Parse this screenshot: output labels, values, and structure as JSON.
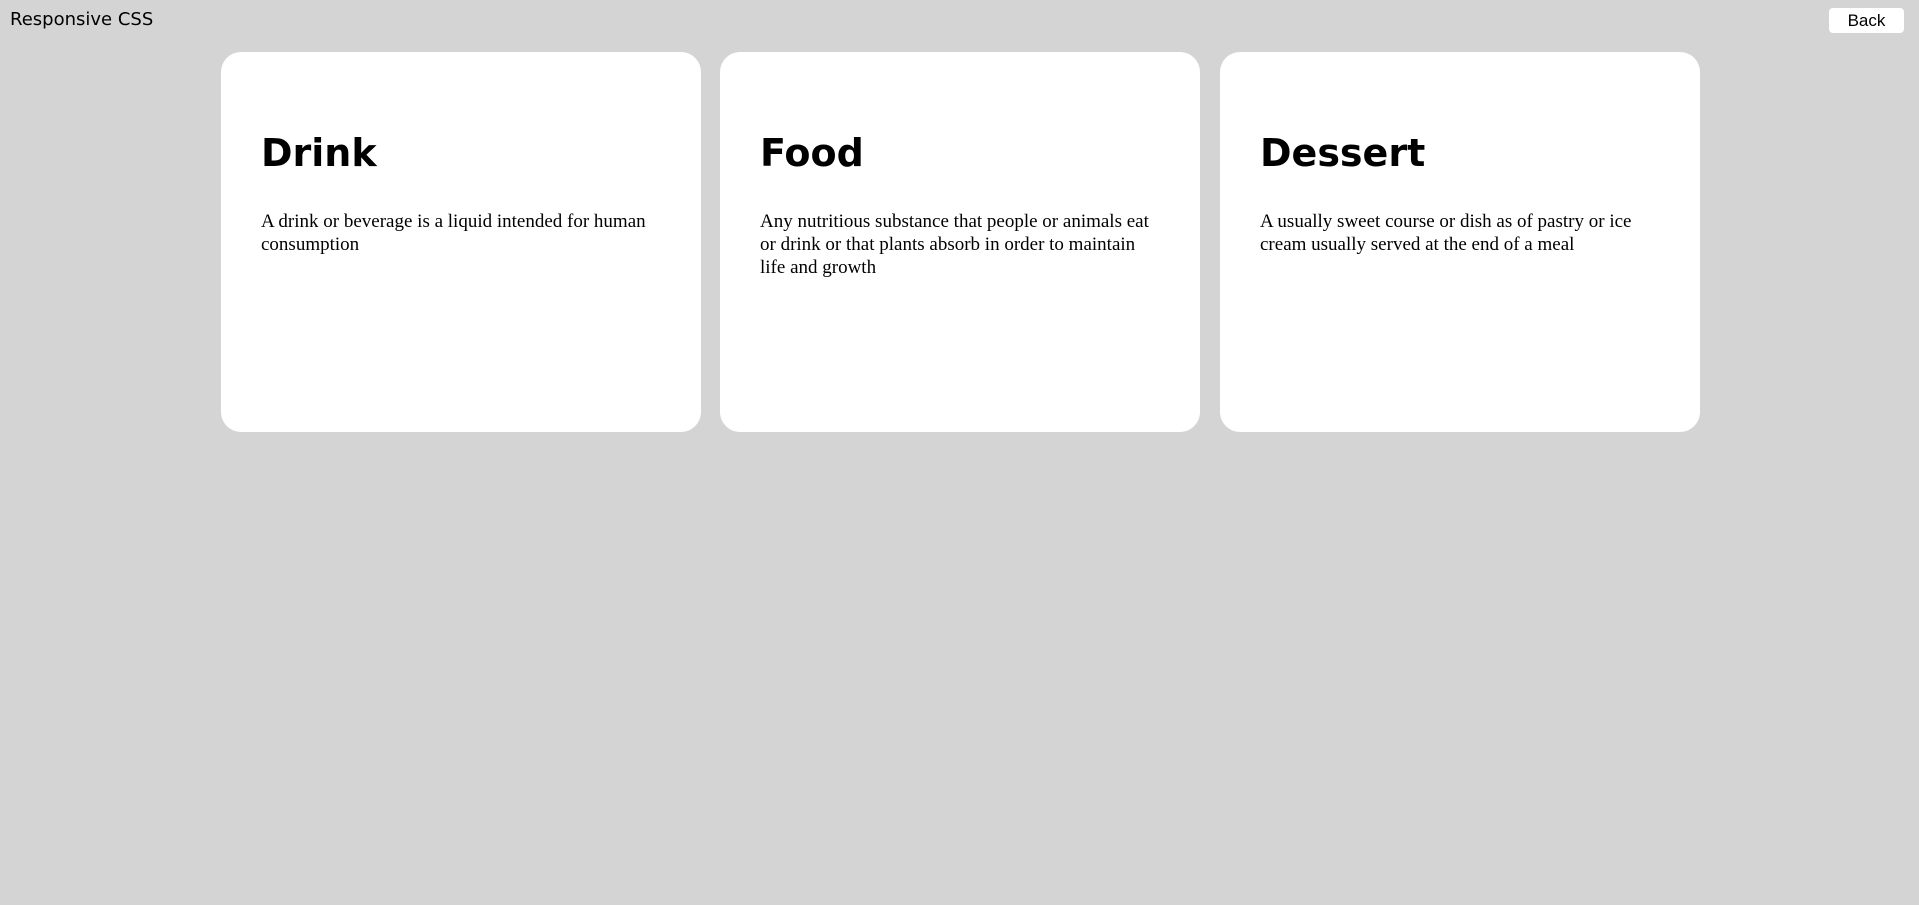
{
  "header": {
    "title": "Responsive CSS",
    "back_label": "Back"
  },
  "colors": {
    "background": "#d4d4d4",
    "card": "#ffffff",
    "text": "#000000"
  },
  "cards": [
    {
      "title": "Drink",
      "description": "A drink or beverage is a liquid intended for human consumption"
    },
    {
      "title": "Food",
      "description": "Any nutritious substance that people or animals eat or drink or that plants absorb in order to maintain life and growth"
    },
    {
      "title": "Dessert",
      "description": "A usually sweet course or dish as of pastry or ice cream usually served at the end of a meal"
    }
  ]
}
